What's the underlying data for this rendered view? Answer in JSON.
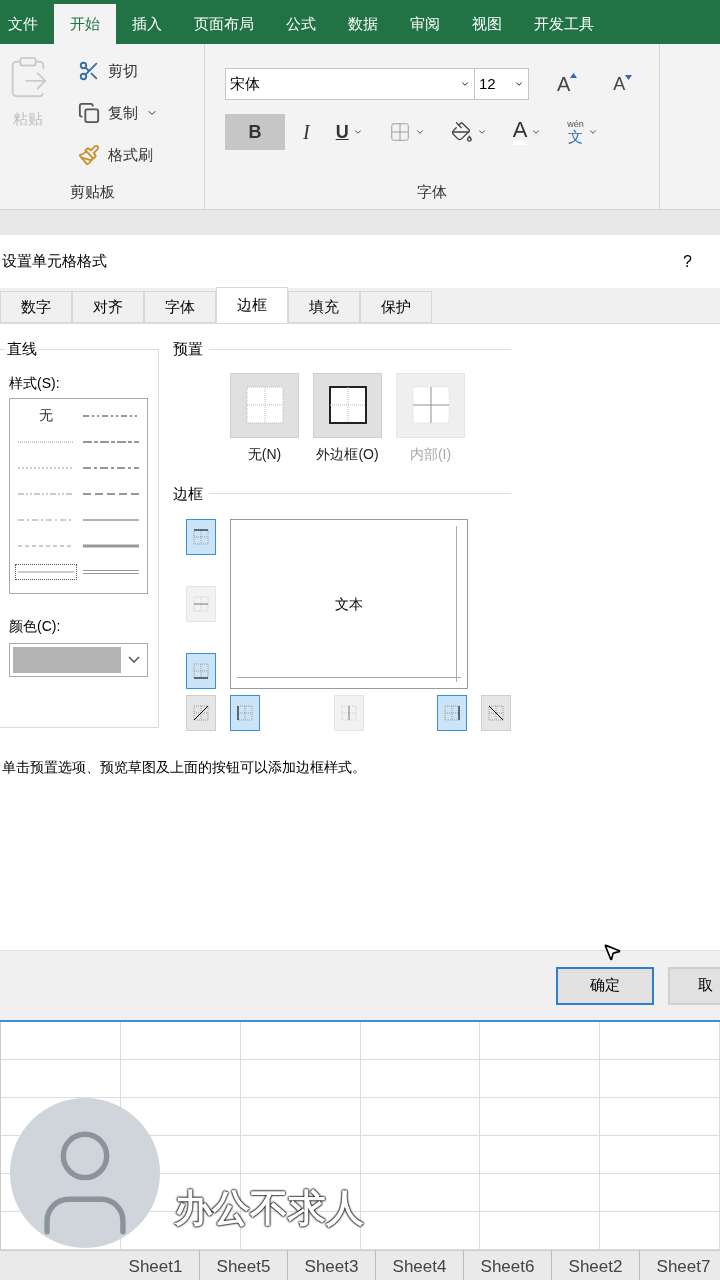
{
  "ribbon": {
    "tabs": [
      {
        "label": "文件",
        "selected": false
      },
      {
        "label": "开始",
        "selected": true
      },
      {
        "label": "插入",
        "selected": false
      },
      {
        "label": "页面布局",
        "selected": false
      },
      {
        "label": "公式",
        "selected": false
      },
      {
        "label": "数据",
        "selected": false
      },
      {
        "label": "审阅",
        "selected": false
      },
      {
        "label": "视图",
        "selected": false
      },
      {
        "label": "开发工具",
        "selected": false
      }
    ],
    "clipboard": {
      "paste": {
        "label": "粘贴",
        "disabled": true
      },
      "items": [
        {
          "kind": "cut",
          "label": "剪切"
        },
        {
          "kind": "copy",
          "label": "复制"
        },
        {
          "kind": "painter",
          "label": "格式刷"
        }
      ],
      "group_label": "剪贴板"
    },
    "font": {
      "font_name": "宋体",
      "font_size": "12",
      "grow_label": "A",
      "shrink_label": "A",
      "buttons": [
        {
          "kind": "bold",
          "label": "B",
          "selected": true
        },
        {
          "kind": "italic",
          "label": "I",
          "selected": false
        },
        {
          "kind": "underline",
          "label": "U",
          "selected": false
        },
        {
          "kind": "borders",
          "selected": false
        },
        {
          "kind": "fill",
          "selected": false
        },
        {
          "kind": "font-color",
          "label": "A",
          "selected": false
        },
        {
          "kind": "phonetic",
          "label": "wén",
          "sub": "文",
          "selected": false
        }
      ],
      "group_label": "字体"
    }
  },
  "dialog": {
    "title": "设置单元格格式",
    "help": "?",
    "tabs": [
      {
        "label": "数字",
        "selected": false
      },
      {
        "label": "对齐",
        "selected": false
      },
      {
        "label": "字体",
        "selected": false
      },
      {
        "label": "边框",
        "selected": true
      },
      {
        "label": "填充",
        "selected": false
      },
      {
        "label": "保护",
        "selected": false
      }
    ],
    "line": {
      "title": "直线",
      "style_label": "样式(S):",
      "styles": [
        {
          "kind": "none",
          "label": "无",
          "selected": false
        },
        {
          "kind": "hair",
          "selected": false
        },
        {
          "kind": "dotted",
          "selected": false
        },
        {
          "kind": "dash-dot-dot",
          "selected": false
        },
        {
          "kind": "dash-dot",
          "selected": false
        },
        {
          "kind": "dashed",
          "selected": false
        },
        {
          "kind": "thin",
          "selected": true
        },
        {
          "kind": "medium-dash-dot-dot",
          "selected": false
        },
        {
          "kind": "slant-dash-dot",
          "selected": false
        },
        {
          "kind": "medium-dash-dot",
          "selected": false
        },
        {
          "kind": "medium-dashed",
          "selected": false
        },
        {
          "kind": "solid",
          "selected": false
        },
        {
          "kind": "thick",
          "selected": false
        },
        {
          "kind": "double",
          "selected": false
        }
      ],
      "color_label": "颜色(C):"
    },
    "presets": {
      "title": "预置",
      "items": [
        {
          "kind": "none",
          "label": "无(N)",
          "disabled": false
        },
        {
          "kind": "outline",
          "label": "外边框(O)",
          "disabled": false
        },
        {
          "kind": "inside",
          "label": "内部(I)",
          "disabled": true
        }
      ]
    },
    "border": {
      "title": "边框",
      "preview_text": "文本",
      "side_buttons": [
        {
          "kind": "top",
          "selected": true,
          "disabled": false
        },
        {
          "kind": "middle-h",
          "selected": false,
          "disabled": true
        },
        {
          "kind": "bottom",
          "selected": true,
          "disabled": false
        }
      ],
      "bottom_buttons": [
        {
          "kind": "diag-up",
          "selected": false,
          "disabled": false
        },
        {
          "kind": "left",
          "selected": true,
          "disabled": false
        },
        {
          "kind": "middle-v",
          "selected": false,
          "disabled": true
        },
        {
          "kind": "right",
          "selected": true,
          "disabled": false
        },
        {
          "kind": "diag-down",
          "selected": false,
          "disabled": false
        }
      ]
    },
    "hint": "单击预置选项、预览草图及上面的按钮可以添加边框样式。",
    "buttons": [
      {
        "label": "确定",
        "focused": true
      },
      {
        "label": "取",
        "focused": false
      }
    ]
  },
  "sheet_tabs": [
    {
      "label": "Sheet1",
      "selected": false
    },
    {
      "label": "Sheet5",
      "selected": false
    },
    {
      "label": "Sheet3",
      "selected": false
    },
    {
      "label": "Sheet4",
      "selected": false
    },
    {
      "label": "Sheet6",
      "selected": false
    },
    {
      "label": "Sheet2",
      "selected": false
    },
    {
      "label": "Sheet7",
      "selected": false
    }
  ],
  "caption": "办公不求人"
}
